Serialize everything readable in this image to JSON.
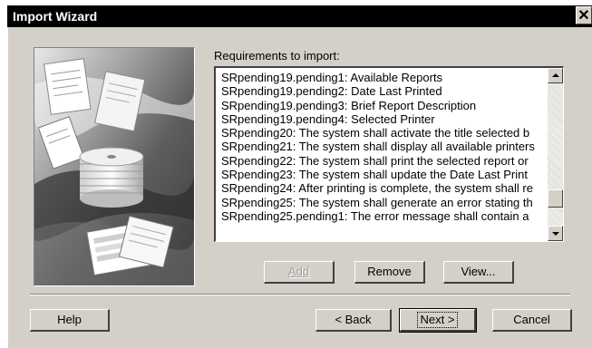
{
  "window": {
    "title": "Import Wizard",
    "close_glyph": "✕"
  },
  "requirements": {
    "label": "Requirements to import:",
    "items": [
      "SRpending19.pending1: Available Reports",
      "SRpending19.pending2: Date Last Printed",
      "SRpending19.pending3: Brief Report Description",
      "SRpending19.pending4: Selected Printer",
      "SRpending20: The system shall activate the title selected b",
      "SRpending21: The system shall display all available printers",
      "SRpending22: The system shall print the selected report or",
      "SRpending23: The system shall update the Date Last Print",
      "SRpending24: After printing is complete, the system shall re",
      "SRpending25: The system shall generate an error stating th",
      "SRpending25.pending1: The error message shall contain a"
    ]
  },
  "list_buttons": {
    "add": "Add",
    "remove": "Remove",
    "view": "View..."
  },
  "footer_buttons": {
    "help": "Help",
    "back": "< Back",
    "next": "Next >",
    "cancel": "Cancel"
  },
  "icons": {
    "close": "close-icon",
    "scroll_up": "arrow-up-icon",
    "scroll_down": "arrow-down-icon",
    "wizard_picture": "documents-and-cd-stack-image"
  },
  "colors": {
    "face": "#d4d0c8",
    "titlebar": "#000000",
    "list_bg": "#ffffff"
  }
}
